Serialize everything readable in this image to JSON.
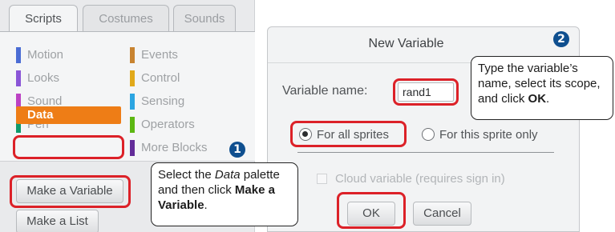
{
  "tabs": [
    {
      "label": "Scripts",
      "active": true
    },
    {
      "label": "Costumes",
      "active": false
    },
    {
      "label": "Sounds",
      "active": false
    }
  ],
  "categories": [
    {
      "label": "Motion",
      "color": "#4a6cd4"
    },
    {
      "label": "Looks",
      "color": "#8a55d7"
    },
    {
      "label": "Sound",
      "color": "#bb42c3"
    },
    {
      "label": "Pen",
      "color": "#0e9a6c"
    },
    {
      "label": "Data",
      "color": "#ee7d16",
      "selected": true
    },
    {
      "label": "Events",
      "color": "#c88330"
    },
    {
      "label": "Control",
      "color": "#e1a91a"
    },
    {
      "label": "Sensing",
      "color": "#2ca5e2"
    },
    {
      "label": "Operators",
      "color": "#5cb712"
    },
    {
      "label": "More Blocks",
      "color": "#632d99"
    }
  ],
  "buttons": {
    "make_variable": "Make a Variable",
    "make_list": "Make a List"
  },
  "dialog": {
    "title": "New Variable",
    "name_label": "Variable name:",
    "name_value": "rand1",
    "scope_all": "For all sprites",
    "scope_this": "For this sprite only",
    "scope_selected": "all",
    "cloud_label": "Cloud variable (requires sign in)",
    "ok_label": "OK",
    "cancel_label": "Cancel"
  },
  "callouts": {
    "one": {
      "badge": "1",
      "text_before_italic": "Select the ",
      "italic": "Data",
      "text_after_italic": " palette and then click ",
      "bold": "Make a Variable",
      "end": "."
    },
    "two": {
      "badge": "2",
      "text_before_bold": "Type the variable’s name, select its scope, and click ",
      "bold": "OK",
      "end": "."
    }
  },
  "colors": {
    "highlight": "#dc2128",
    "badge": "#0f4f8f",
    "data_orange": "#ee7d16"
  }
}
